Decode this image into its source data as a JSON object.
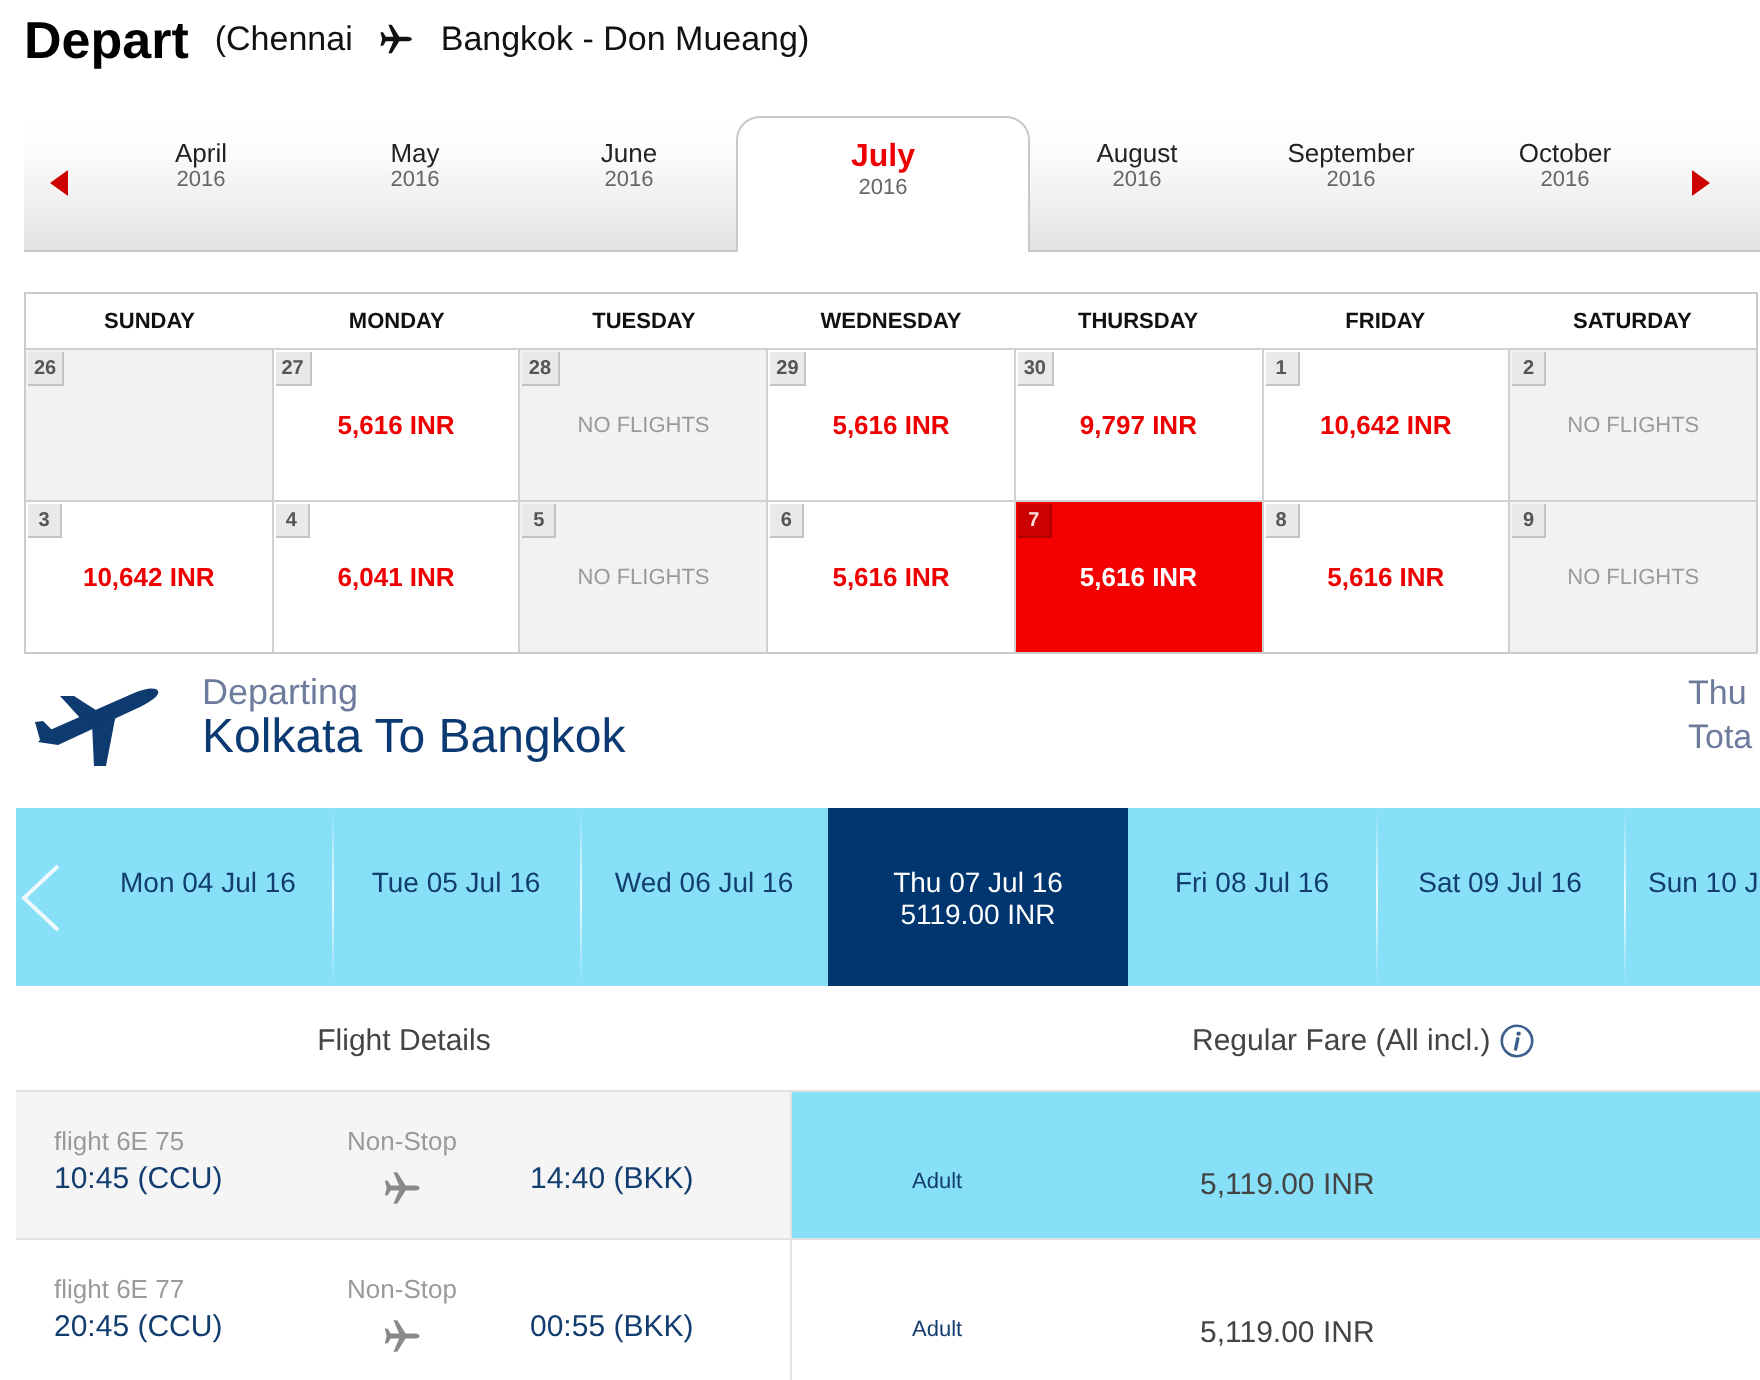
{
  "header": {
    "title": "Depart",
    "origin": "(Chennai",
    "destination": "Bangkok - Don Mueang)"
  },
  "month_tabs": [
    {
      "month": "April",
      "year": "2016",
      "selected": false
    },
    {
      "month": "May",
      "year": "2016",
      "selected": false
    },
    {
      "month": "June",
      "year": "2016",
      "selected": false
    },
    {
      "month": "July",
      "year": "2016",
      "selected": true
    },
    {
      "month": "August",
      "year": "2016",
      "selected": false
    },
    {
      "month": "September",
      "year": "2016",
      "selected": false
    },
    {
      "month": "October",
      "year": "2016",
      "selected": false
    }
  ],
  "calendar": {
    "weekdays": [
      "SUNDAY",
      "MONDAY",
      "TUESDAY",
      "WEDNESDAY",
      "THURSDAY",
      "FRIDAY",
      "SATURDAY"
    ],
    "weeks": [
      [
        {
          "day": "26",
          "kind": "empty",
          "selected": false
        },
        {
          "day": "27",
          "kind": "fare",
          "text": "5,616 INR",
          "selected": false
        },
        {
          "day": "28",
          "kind": "no_flights",
          "text": "NO FLIGHTS",
          "selected": false
        },
        {
          "day": "29",
          "kind": "fare",
          "text": "5,616 INR",
          "selected": false
        },
        {
          "day": "30",
          "kind": "fare",
          "text": "9,797 INR",
          "selected": false
        },
        {
          "day": "1",
          "kind": "fare",
          "text": "10,642 INR",
          "selected": false
        },
        {
          "day": "2",
          "kind": "no_flights",
          "text": "NO FLIGHTS",
          "selected": false
        }
      ],
      [
        {
          "day": "3",
          "kind": "fare",
          "text": "10,642 INR",
          "selected": false
        },
        {
          "day": "4",
          "kind": "fare",
          "text": "6,041 INR",
          "selected": false
        },
        {
          "day": "5",
          "kind": "no_flights",
          "text": "NO FLIGHTS",
          "selected": false
        },
        {
          "day": "6",
          "kind": "fare",
          "text": "5,616 INR",
          "selected": false
        },
        {
          "day": "7",
          "kind": "fare",
          "text": "5,616 INR",
          "selected": true
        },
        {
          "day": "8",
          "kind": "fare",
          "text": "5,616 INR",
          "selected": false
        },
        {
          "day": "9",
          "kind": "no_flights",
          "text": "NO FLIGHTS",
          "selected": false
        }
      ]
    ]
  },
  "departing": {
    "label": "Departing",
    "route": "Kolkata To Bangkok",
    "cut_off_text": [
      "Thu",
      "Tota"
    ]
  },
  "date_tabs": [
    {
      "label": "Mon 04 Jul 16",
      "selected": false
    },
    {
      "label": "Tue 05 Jul 16",
      "selected": false
    },
    {
      "label": "Wed 06 Jul 16",
      "selected": false
    },
    {
      "label": "Thu 07 Jul 16",
      "fare": "5119.00 INR",
      "selected": true
    },
    {
      "label": "Fri 08 Jul 16",
      "selected": false
    },
    {
      "label": "Sat 09 Jul 16",
      "selected": false
    },
    {
      "label": "Sun 10 J",
      "selected": false
    }
  ],
  "fare_table": {
    "columns": [
      "Flight Details",
      "Regular Fare (All incl.)"
    ],
    "rows": [
      {
        "flight": "flight 6E 75",
        "departure": "10:45 (CCU)",
        "stops": "Non-Stop",
        "arrival": "14:40 (BKK)",
        "passenger": "Adult",
        "fare": "5,119.00 INR",
        "selected": true
      },
      {
        "flight": "flight 6E 77",
        "departure": "20:45 (CCU)",
        "stops": "Non-Stop",
        "arrival": "00:55 (BKK)",
        "passenger": "Adult",
        "fare": "5,119.00 INR",
        "selected": false
      }
    ]
  }
}
